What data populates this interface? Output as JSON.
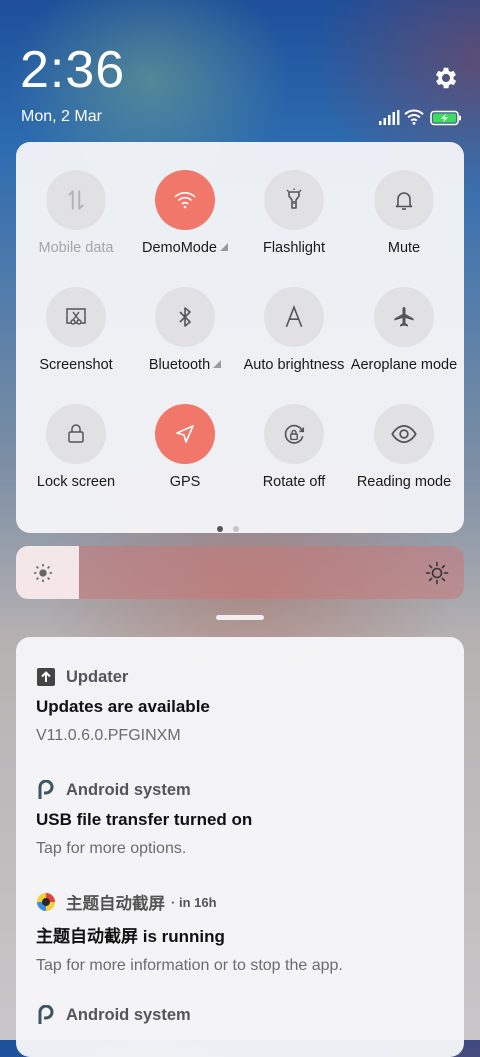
{
  "status": {
    "time": "2:36",
    "date": "Mon, 2 Mar"
  },
  "icons": {
    "settings": "gear-icon",
    "signal": "signal-icon",
    "wifi": "wifi-icon",
    "battery": "battery-charging-icon"
  },
  "quick_settings": {
    "tiles": [
      {
        "label": "Mobile data",
        "icon": "mobile-data-icon",
        "active": false,
        "disabled": true
      },
      {
        "label": "DemoMode",
        "icon": "wifi-icon",
        "active": true,
        "expandable": true
      },
      {
        "label": "Flashlight",
        "icon": "flashlight-icon",
        "active": false
      },
      {
        "label": "Mute",
        "icon": "bell-icon",
        "active": false
      },
      {
        "label": "Screenshot",
        "icon": "screenshot-icon",
        "active": false
      },
      {
        "label": "Bluetooth",
        "icon": "bluetooth-icon",
        "active": false,
        "expandable": true
      },
      {
        "label": "Auto brightness",
        "icon": "auto-brightness-icon",
        "active": false
      },
      {
        "label": "Aeroplane mode",
        "icon": "airplane-icon",
        "active": false
      },
      {
        "label": "Lock screen",
        "icon": "lock-icon",
        "active": false
      },
      {
        "label": "GPS",
        "icon": "location-icon",
        "active": true
      },
      {
        "label": "Rotate off",
        "icon": "rotate-lock-icon",
        "active": false
      },
      {
        "label": "Reading mode",
        "icon": "eye-icon",
        "active": false
      }
    ],
    "page_current": 1,
    "page_count": 2
  },
  "brightness": {
    "level": 0.14
  },
  "colors": {
    "accent": "#f0776a",
    "tile_off": "#e1e1e3",
    "panel": "#f6f6f8"
  },
  "notifications": [
    {
      "app": "Updater",
      "title": "Updates are available",
      "text": "V11.0.6.0.PFGINXM",
      "time": ""
    },
    {
      "app": "Android system",
      "title": "USB file transfer turned on",
      "text": "Tap for more options.",
      "time": ""
    },
    {
      "app": "主题自动截屏",
      "title": "主题自动截屏 is running",
      "text": "Tap for more information or to stop the app.",
      "time": "in 16h"
    },
    {
      "app": "Android system",
      "title": "",
      "text": "",
      "time": ""
    }
  ]
}
